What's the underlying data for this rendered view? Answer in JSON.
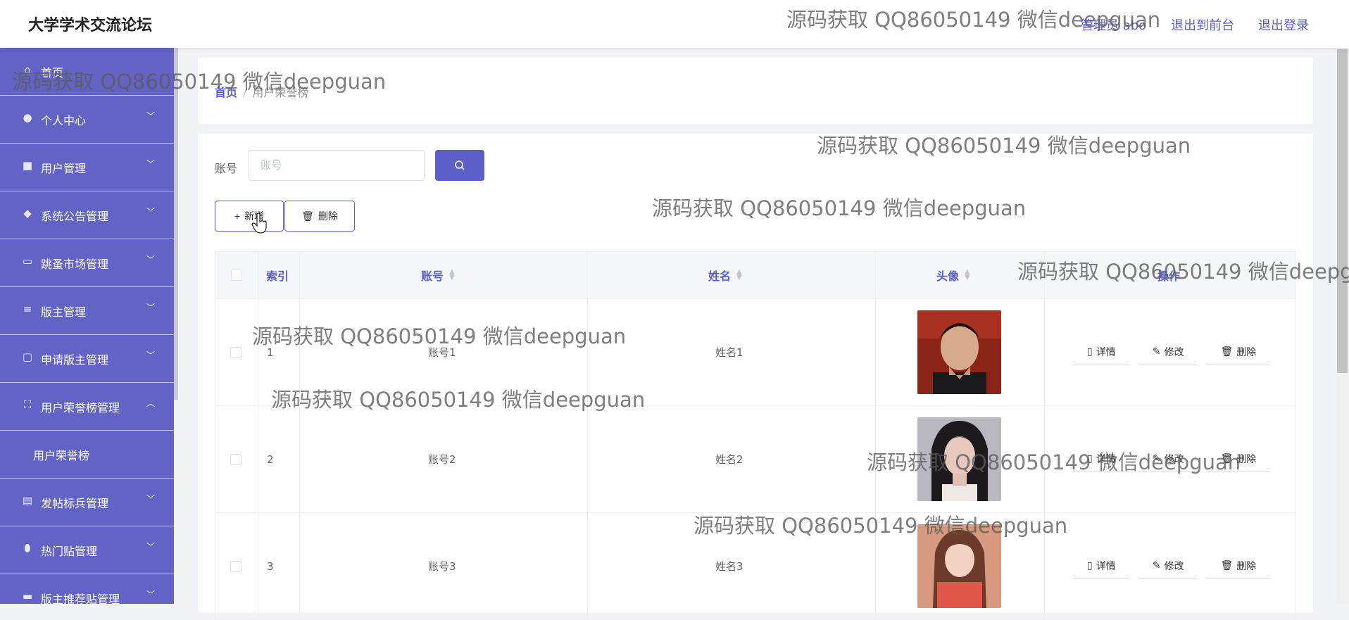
{
  "header": {
    "brand": "大学学术交流论坛",
    "user": "管理员 abo",
    "to_front": "退出到前台",
    "logout": "退出登录"
  },
  "sidebar": {
    "items": [
      {
        "label": "首页",
        "icon": "home-icon"
      },
      {
        "label": "个人中心",
        "icon": "user-icon"
      },
      {
        "label": "用户管理",
        "icon": "briefcase-icon"
      },
      {
        "label": "系统公告管理",
        "icon": "location-icon"
      },
      {
        "label": "跳蚤市场管理",
        "icon": "chat-icon"
      },
      {
        "label": "版主管理",
        "icon": "sliders-icon"
      },
      {
        "label": "申请版主管理",
        "icon": "monitor-icon"
      },
      {
        "label": "用户荣誉榜管理",
        "icon": "frame-icon"
      },
      {
        "label": "发帖标兵管理",
        "icon": "clipboard-icon"
      },
      {
        "label": "热门贴管理",
        "icon": "mic-icon"
      },
      {
        "label": "版主推荐贴管理",
        "icon": "screen-icon"
      }
    ],
    "sub_item": "用户荣誉榜"
  },
  "breadcrumb": {
    "home": "首页",
    "separator": "/",
    "current": "用户荣誉榜"
  },
  "search": {
    "label": "账号",
    "placeholder": "账号"
  },
  "actions": {
    "add": "新增",
    "delete": "删除"
  },
  "table": {
    "headers": {
      "index": "索引",
      "account": "账号",
      "name": "姓名",
      "avatar": "头像",
      "ops": "操作"
    },
    "rows": [
      {
        "index": "1",
        "account": "账号1",
        "name": "姓名1"
      },
      {
        "index": "2",
        "account": "账号2",
        "name": "姓名2"
      },
      {
        "index": "3",
        "account": "账号3",
        "name": "姓名3"
      }
    ],
    "row_actions": {
      "detail": "详情",
      "edit": "修改",
      "delete": "删除"
    }
  },
  "watermark": "源码获取 QQ86050149 微信deepguan",
  "colors": {
    "accent": "#5b5fc7",
    "sidebar": "#6263c4"
  }
}
